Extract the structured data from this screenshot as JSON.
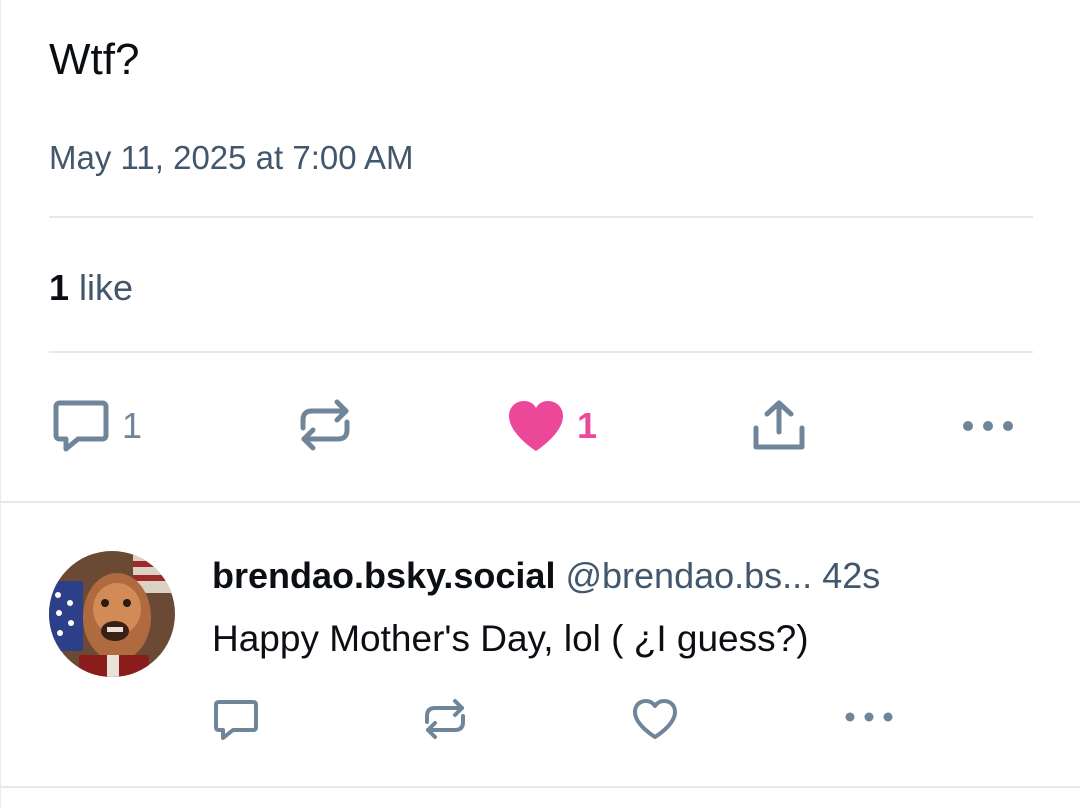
{
  "post": {
    "text": "Wtf?",
    "timestamp": "May 11, 2025 at 7:00 AM",
    "likes_summary": {
      "count": "1",
      "label": "like"
    },
    "actions": {
      "reply_count": "1",
      "repost_count": "",
      "like_count": "1",
      "liked": true
    }
  },
  "reply": {
    "display_name": "brendao.bsky.social",
    "handle": "@brendao.bs...",
    "age": "42s",
    "text": "Happy Mother's Day, lol ( ¿I guess?)",
    "actions": {
      "reply_count": "",
      "repost_count": "",
      "like_count": ""
    }
  },
  "colors": {
    "text": "#0b0f14",
    "muted": "#42576c",
    "icon": "#6f8599",
    "like_accent": "#ec4899",
    "divider": "#e5e9ed"
  },
  "icons": {
    "reply": "speech-bubble-icon",
    "repost": "repost-arrows-icon",
    "like": "heart-icon",
    "share": "share-icon",
    "more": "ellipsis-icon"
  }
}
